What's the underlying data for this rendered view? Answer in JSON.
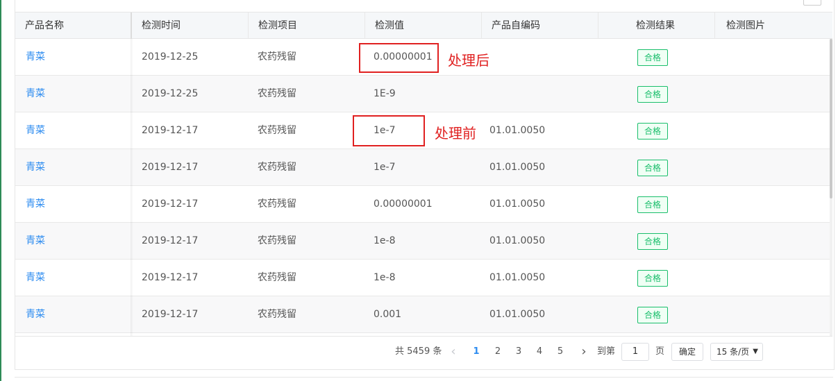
{
  "headers": [
    "产品名称",
    "检测时间",
    "检测项目",
    "检测值",
    "产品自编码",
    "检测结果",
    "检测图片"
  ],
  "rows": [
    {
      "name": "青菜",
      "date": "2019-12-25",
      "item": "农药残留",
      "value": "0.00000001",
      "code": "",
      "result": "合格"
    },
    {
      "name": "青菜",
      "date": "2019-12-25",
      "item": "农药残留",
      "value": "1E-9",
      "code": "",
      "result": "合格"
    },
    {
      "name": "青菜",
      "date": "2019-12-17",
      "item": "农药残留",
      "value": "1e-7",
      "code": "01.01.0050",
      "result": "合格"
    },
    {
      "name": "青菜",
      "date": "2019-12-17",
      "item": "农药残留",
      "value": "1e-7",
      "code": "01.01.0050",
      "result": "合格"
    },
    {
      "name": "青菜",
      "date": "2019-12-17",
      "item": "农药残留",
      "value": "0.00000001",
      "code": "01.01.0050",
      "result": "合格"
    },
    {
      "name": "青菜",
      "date": "2019-12-17",
      "item": "农药残留",
      "value": "1e-8",
      "code": "01.01.0050",
      "result": "合格"
    },
    {
      "name": "青菜",
      "date": "2019-12-17",
      "item": "农药残留",
      "value": "1e-8",
      "code": "01.01.0050",
      "result": "合格"
    },
    {
      "name": "青菜",
      "date": "2019-12-17",
      "item": "农药残留",
      "value": "0.001",
      "code": "01.01.0050",
      "result": "合格"
    }
  ],
  "annotations": {
    "after": "处理后",
    "before": "处理前"
  },
  "pagination": {
    "total": "共 5459 条",
    "pages": [
      "1",
      "2",
      "3",
      "4",
      "5"
    ],
    "active_page": "1",
    "prev_icon": "‹",
    "next_icon": "›",
    "jump_label": "到第",
    "jump_value": "1",
    "page_unit": "页",
    "confirm": "确定",
    "page_size": "15 条/页"
  },
  "colors": {
    "link": "#2d8cf0",
    "success": "#19be6b",
    "annotation": "#e02020"
  }
}
